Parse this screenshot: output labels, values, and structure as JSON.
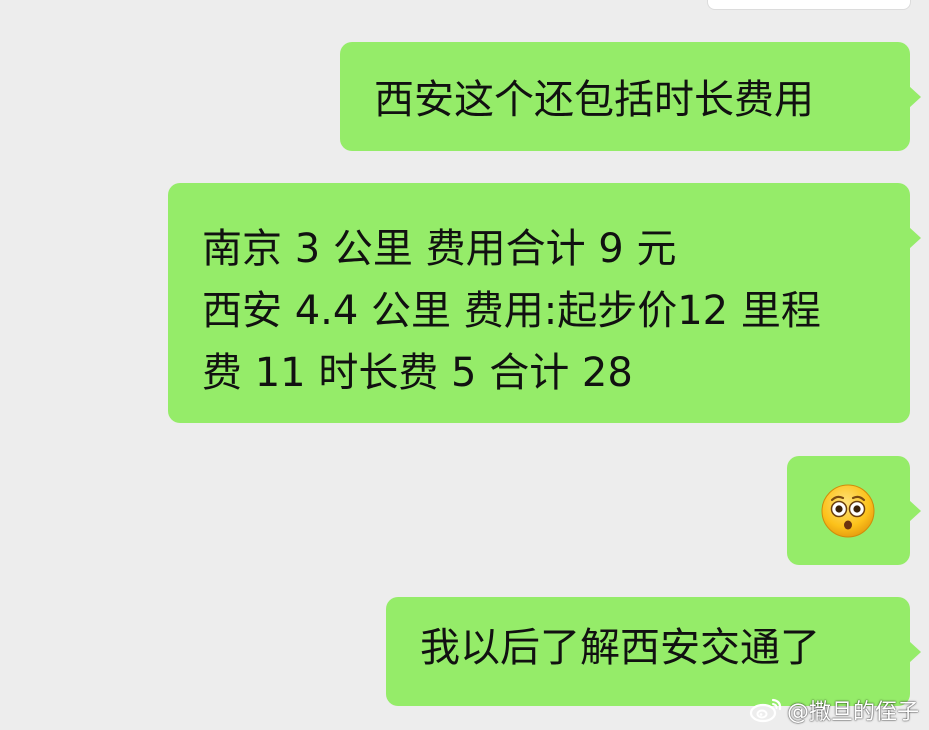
{
  "messages": [
    {
      "text": "西安这个还包括时长费用"
    },
    {
      "lines": [
        "南京 3 公里 费用合计 9 元",
        "西安 4.4 公里 费用:起步价12 里程",
        "费 11 时长费 5  合计 28"
      ]
    },
    {
      "emoji": "flushed-face-emoji"
    },
    {
      "text": "我以后了解西安交通了"
    }
  ],
  "watermark": {
    "handle": "@撒旦的侄子",
    "icon": "weibo-logo"
  },
  "colors": {
    "background": "#ededed",
    "outgoing_bubble": "#95ec69",
    "text": "#111111"
  }
}
